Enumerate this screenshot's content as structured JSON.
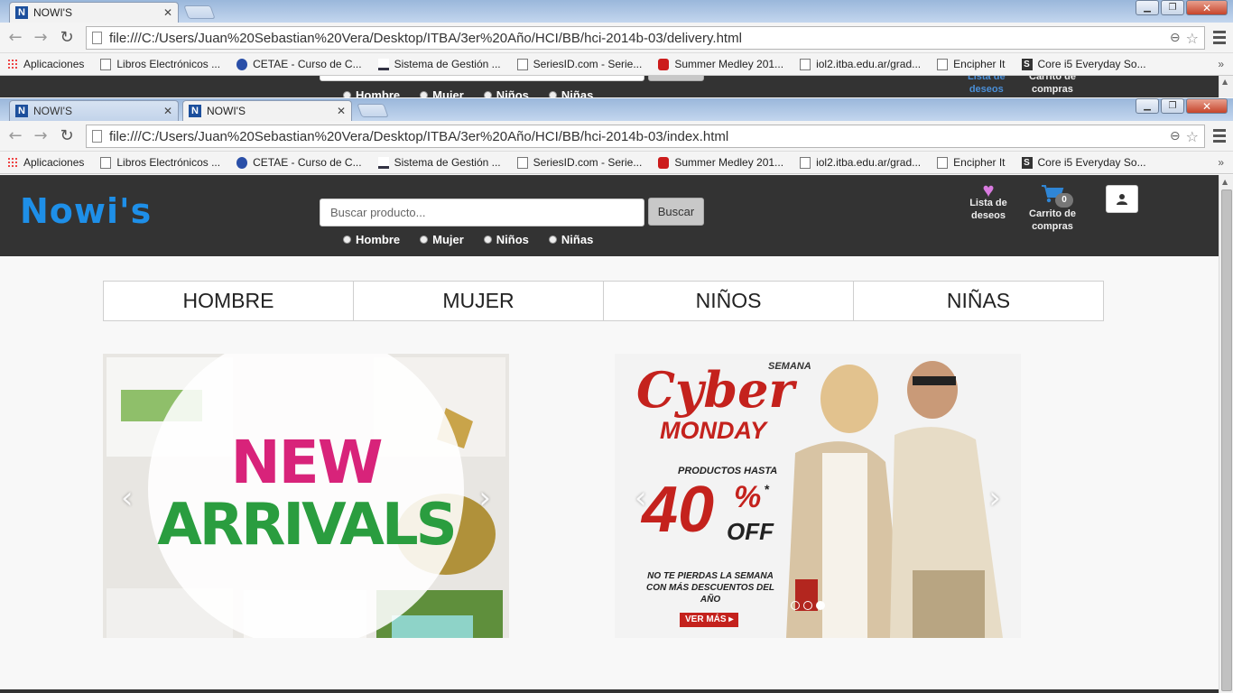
{
  "back_window": {
    "tab_title": "NOWI'S",
    "url": "file:///C:/Users/Juan%20Sebastian%20Vera/Desktop/ITBA/3er%20Año/HCI/BB/hci-2014b-03/delivery.html"
  },
  "front_window": {
    "tabs": [
      {
        "title": "NOWI'S"
      },
      {
        "title": "NOWI'S"
      }
    ],
    "url": "file:///C:/Users/Juan%20Sebastian%20Vera/Desktop/ITBA/3er%20Año/HCI/BB/hci-2014b-03/index.html"
  },
  "favicon_letter": "N",
  "bookmarks": [
    {
      "label": "Aplicaciones",
      "icon": "apps-icon"
    },
    {
      "label": "Libros Electrónicos ...",
      "icon": "page-icon"
    },
    {
      "label": "CETAE - Curso de C...",
      "icon": "globe-icon"
    },
    {
      "label": "Sistema de Gestión ...",
      "icon": "wave-icon"
    },
    {
      "label": "SeriesID.com - Serie...",
      "icon": "page-icon"
    },
    {
      "label": "Summer Medley 201...",
      "icon": "youtube-icon"
    },
    {
      "label": "iol2.itba.edu.ar/grad...",
      "icon": "page-icon"
    },
    {
      "label": "Encipher It",
      "icon": "page-icon"
    },
    {
      "label": "Core i5 Everyday So...",
      "icon": "s-icon"
    }
  ],
  "bookmarks_more": "»",
  "site": {
    "logo": "Nowi's",
    "search_placeholder": "Buscar producto...",
    "search_button": "Buscar",
    "filters": [
      "Hombre",
      "Mujer",
      "Niños",
      "Niñas"
    ],
    "wishlist_label_1": "Lista de",
    "wishlist_label_2": "deseos",
    "cart_label_1": "Carrito de",
    "cart_label_2": "compras",
    "cart_count": "0",
    "categories": [
      "HOMBRE",
      "MUJER",
      "NIÑOS",
      "NIÑAS"
    ],
    "banner_left": {
      "line1": "NEW",
      "line2": "ARRIVALS"
    },
    "banner_right": {
      "semana": "SEMANA",
      "cyber": "Cyber",
      "monday": "MONDAY",
      "productos": "PRODUCTOS HASTA",
      "percent": "40",
      "pct_sign": "%",
      "asterisk": "*",
      "off": "OFF",
      "tagline_1": "NO TE PIERDAS LA SEMANA",
      "tagline_2": "CON MÁS DESCUENTOS DEL AÑO",
      "cta": "VER MÁS"
    }
  },
  "colors": {
    "header_bg": "#333333",
    "logo": "#1e8fe8",
    "heart": "#d97be0",
    "cart": "#2f86d6"
  }
}
